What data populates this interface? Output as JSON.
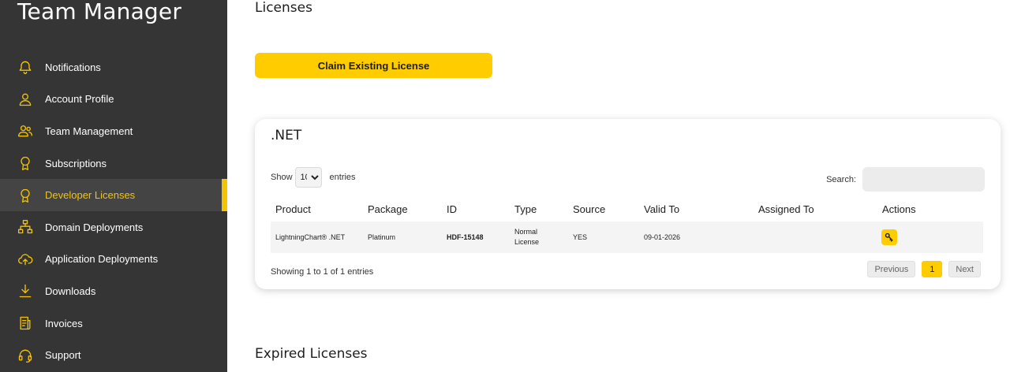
{
  "sidebar": {
    "brand": "Team Manager",
    "items": [
      {
        "label": "Notifications",
        "icon": "bell-icon"
      },
      {
        "label": "Account Profile",
        "icon": "user-icon"
      },
      {
        "label": "Team Management",
        "icon": "users-icon"
      },
      {
        "label": "Subscriptions",
        "icon": "badge-icon"
      },
      {
        "label": "Developer Licenses",
        "icon": "badge-icon",
        "active": true
      },
      {
        "label": "Domain Deployments",
        "icon": "sitemap-icon"
      },
      {
        "label": "Application Deployments",
        "icon": "cloud-upload-icon"
      },
      {
        "label": "Downloads",
        "icon": "download-icon"
      },
      {
        "label": "Invoices",
        "icon": "invoice-icon"
      },
      {
        "label": "Support",
        "icon": "headset-icon"
      }
    ]
  },
  "main": {
    "title": "Licenses",
    "claim_button": "Claim Existing License",
    "expired_title": "Expired Licenses"
  },
  "card": {
    "title": ".NET",
    "show_label": "Show",
    "page_length": "10",
    "entries_label": "entries",
    "search_label": "Search:",
    "search_value": "",
    "columns": [
      "Product",
      "Package",
      "ID",
      "Type",
      "Source",
      "Valid To",
      "Assigned To",
      "Actions"
    ],
    "rows": [
      {
        "product": "LightningChart® .NET",
        "package": "Platinum",
        "id": "HDF-15148",
        "type": "Normal License",
        "source": "YES",
        "valid_to": "09-01-2026",
        "assigned_to": "",
        "action_icon": "key-icon"
      }
    ],
    "info": "Showing 1 to 1 of 1 entries",
    "pagination": {
      "previous": "Previous",
      "current": "1",
      "next": "Next"
    }
  },
  "colors": {
    "accent": "#ffcc00",
    "sidebar_bg": "#353535",
    "active_bg": "#444444"
  }
}
